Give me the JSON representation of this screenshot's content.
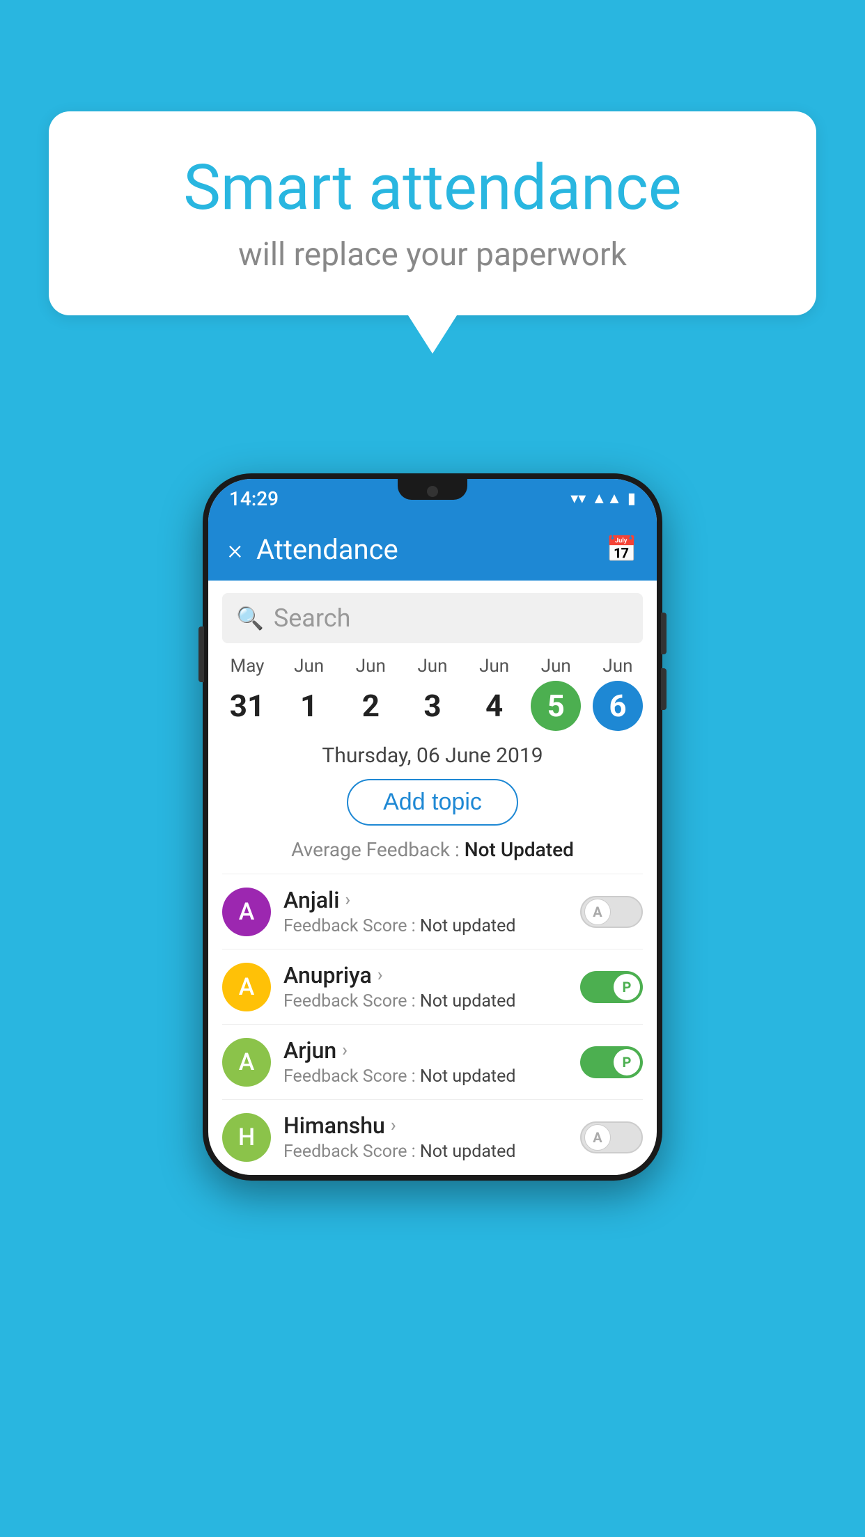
{
  "background_color": "#29B6E0",
  "bubble": {
    "title": "Smart attendance",
    "subtitle": "will replace your paperwork"
  },
  "app": {
    "status_bar": {
      "time": "14:29"
    },
    "title": "Attendance",
    "close_label": "×",
    "search_placeholder": "Search",
    "selected_date_label": "Thursday, 06 June 2019",
    "add_topic_label": "Add topic",
    "feedback_label": "Average Feedback :",
    "feedback_value": "Not Updated",
    "calendar": {
      "days": [
        {
          "month": "May",
          "date": "31",
          "state": "normal"
        },
        {
          "month": "Jun",
          "date": "1",
          "state": "normal"
        },
        {
          "month": "Jun",
          "date": "2",
          "state": "normal"
        },
        {
          "month": "Jun",
          "date": "3",
          "state": "normal"
        },
        {
          "month": "Jun",
          "date": "4",
          "state": "normal"
        },
        {
          "month": "Jun",
          "date": "5",
          "state": "today"
        },
        {
          "month": "Jun",
          "date": "6",
          "state": "selected"
        }
      ]
    },
    "students": [
      {
        "name": "Anjali",
        "avatar_letter": "A",
        "avatar_color": "#9C27B0",
        "feedback": "Feedback Score : Not updated",
        "toggle_state": "off",
        "toggle_letter": "A"
      },
      {
        "name": "Anupriya",
        "avatar_letter": "A",
        "avatar_color": "#FFC107",
        "feedback": "Feedback Score : Not updated",
        "toggle_state": "on",
        "toggle_letter": "P"
      },
      {
        "name": "Arjun",
        "avatar_letter": "A",
        "avatar_color": "#8BC34A",
        "feedback": "Feedback Score : Not updated",
        "toggle_state": "on",
        "toggle_letter": "P"
      },
      {
        "name": "Himanshu",
        "avatar_letter": "H",
        "avatar_color": "#8BC34A",
        "feedback": "Feedback Score : Not updated",
        "toggle_state": "off",
        "toggle_letter": "A"
      }
    ]
  }
}
